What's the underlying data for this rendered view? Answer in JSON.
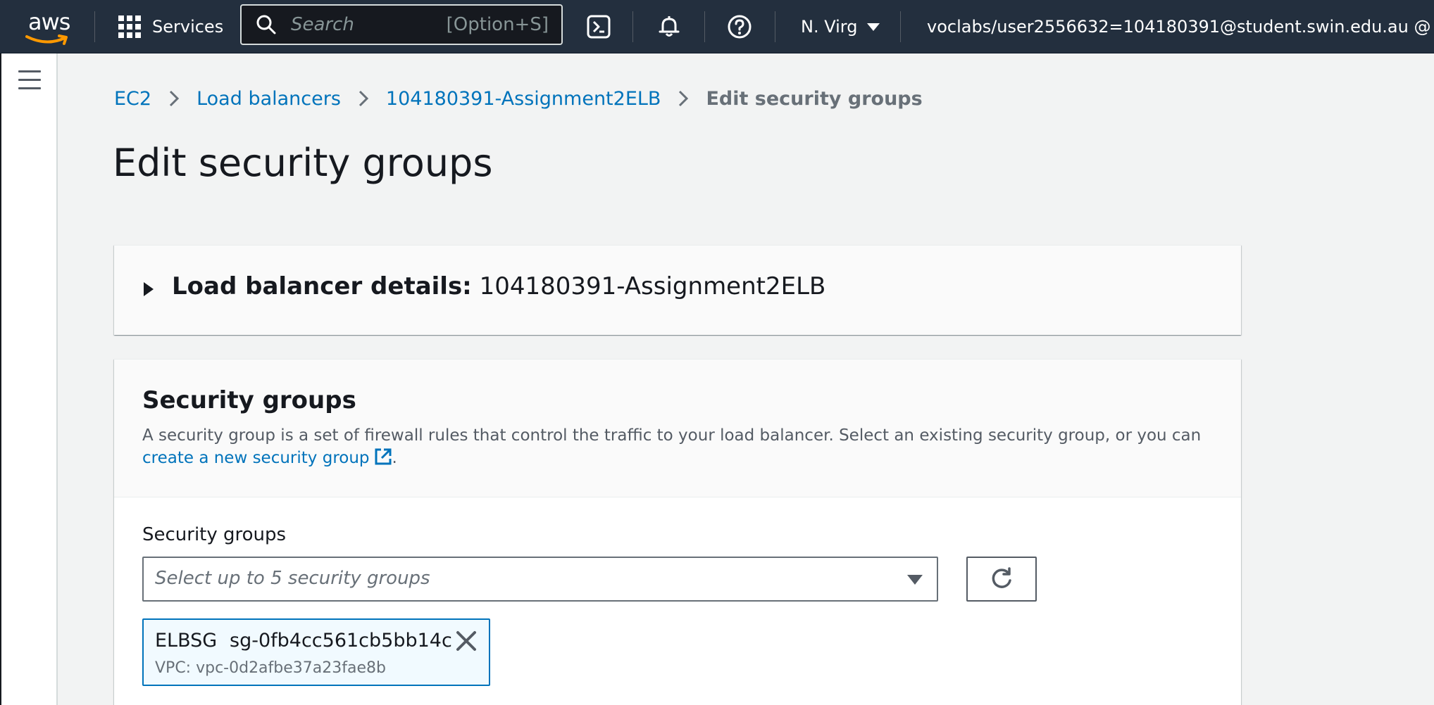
{
  "nav": {
    "logo_text": "aws",
    "services_label": "Services",
    "search_placeholder": "Search",
    "search_shortcut": "[Option+S]",
    "region": "N. Virg",
    "account": "voclabs/user2556632=104180391@student.swin.edu.au @"
  },
  "breadcrumb": {
    "items": [
      "EC2",
      "Load balancers",
      "104180391-Assignment2ELB"
    ],
    "current": "Edit security groups"
  },
  "page_title": "Edit security groups",
  "lb_details": {
    "label": "Load balancer details:",
    "name": "104180391-Assignment2ELB"
  },
  "security_groups": {
    "heading": "Security groups",
    "description": "A security group is a set of firewall rules that control the traffic to your load balancer. Select an existing security group, or you can ",
    "create_link": "create a new security group",
    "period": ".",
    "field_label": "Security groups",
    "select_placeholder": "Select up to 5 security groups",
    "selected": [
      {
        "name": "ELBSG",
        "id": "sg-0fb4cc561cb5bb14c",
        "vpc": "VPC: vpc-0d2afbe37a23fae8b"
      }
    ]
  },
  "colors": {
    "nav_bg": "#232f3e",
    "link": "#0073bb",
    "token_bg": "#f1faff"
  }
}
